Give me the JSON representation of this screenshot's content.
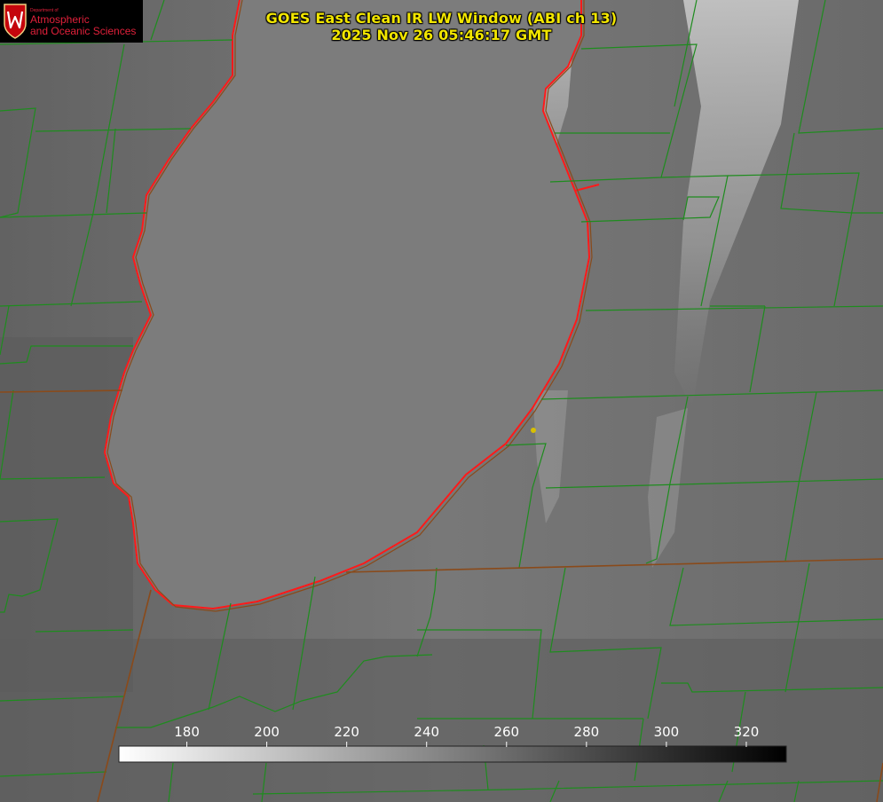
{
  "header": {
    "title": "GOES East Clean IR LW Window (ABI ch 13)",
    "timestamp": "2025 Nov 26 05:46:17 GMT",
    "title_color": "#f2e600"
  },
  "logo": {
    "dept": "Department of",
    "line1": "Atmospheric",
    "line2": "and Oceanic Sciences",
    "color": "#e0203a"
  },
  "colorbar": {
    "ticks": [
      "180",
      "200",
      "220",
      "240",
      "260",
      "280",
      "300",
      "320"
    ],
    "min": 163,
    "max": 330,
    "palette": "white-to-black"
  },
  "map": {
    "county_line_color": "#1e8c1e",
    "state_line_color": "#8a4a1a",
    "lake_outline_color": "#ff1a1a"
  }
}
